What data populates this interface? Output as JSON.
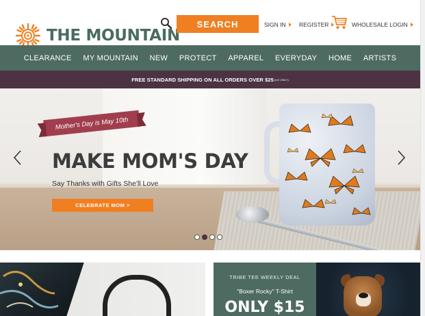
{
  "header": {
    "logo_text": "THE MOUNTAIN",
    "logo_mark": "®",
    "search_label": "SEARCH",
    "sign_in": "SIGN IN",
    "register": "REGISTER",
    "wholesale": "WHOLESALE LOGIN",
    "icons": [
      "sun-logo-icon",
      "magnifier-icon",
      "shopping-cart-icon",
      "orange-arrow-icon"
    ]
  },
  "nav": {
    "items": [
      "CLEARANCE",
      "MY MOUNTAIN",
      "NEW",
      "PROTECT",
      "APPAREL",
      "EVERYDAY",
      "HOME",
      "ARTISTS"
    ]
  },
  "shipping": {
    "text": "FREE STANDARD SHIPPING ON ALL ORDERS OVER $25",
    "small": "(US ONLY)"
  },
  "hero": {
    "ribbon": "Mother's Day is May 10th",
    "title": "MAKE MOM'S DAY",
    "subtitle": "Say Thanks with Gifts She'll Love",
    "cta": "CELEBRATE MOM >",
    "slide_count": 4,
    "active_slide": 2
  },
  "tiles": {
    "deal_label": "TRIBE TEE WEEKLY DEAL",
    "deal_name": "\"Boxer Rocky\" T-Shirt",
    "deal_price": "ONLY $15"
  },
  "colors": {
    "orange": "#f07f22",
    "nav_green": "#4e6b61",
    "shipping_plum": "#4c3343",
    "logo_green": "#4a6b63",
    "ribbon_red": "#a13e4d"
  }
}
